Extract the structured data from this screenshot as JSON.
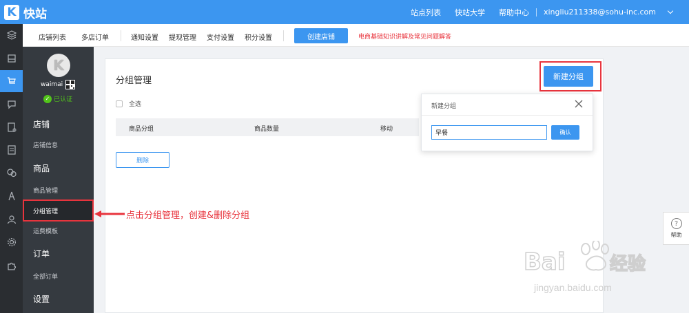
{
  "app": {
    "logo_letter": "K",
    "name": "快站"
  },
  "top_nav": {
    "items": [
      "站点列表",
      "快站大学",
      "帮助中心"
    ],
    "user_email": "xingliu211338@sohu-inc.com"
  },
  "sub_nav": {
    "items": [
      "店铺列表",
      "多店订单",
      "通知设置",
      "提现管理",
      "支付设置",
      "积分设置"
    ],
    "create_shop": "创建店铺",
    "faq_link": "电商基础知识讲解及常见问题解答"
  },
  "sidebar": {
    "shop_name": "waimai",
    "verified": "已认证",
    "sections": [
      {
        "title": "店铺",
        "items": [
          "店铺信息"
        ]
      },
      {
        "title": "商品",
        "items": [
          "商品管理",
          "分组管理",
          "运费模板"
        ]
      },
      {
        "title": "订单",
        "items": [
          "全部订单"
        ]
      },
      {
        "title": "设置",
        "items": []
      }
    ]
  },
  "main": {
    "title": "分组管理",
    "new_group_button": "新建分组",
    "select_all": "全选",
    "columns": [
      "商品分组",
      "商品数量",
      "移动"
    ],
    "delete_button": "删除"
  },
  "popover": {
    "title": "新建分组",
    "input_value": "早餐",
    "confirm": "确认"
  },
  "annotation": "点击分组管理，创建&删除分组",
  "help": {
    "label": "帮助",
    "symbol": "?"
  },
  "watermark": {
    "logo_text": "Bai经验",
    "url": "jingyan.baidu.com"
  },
  "colors": {
    "primary": "#3c96f0",
    "highlight": "#e8343d",
    "sidebar": "#353a40",
    "iconbar": "#2a2d31"
  }
}
